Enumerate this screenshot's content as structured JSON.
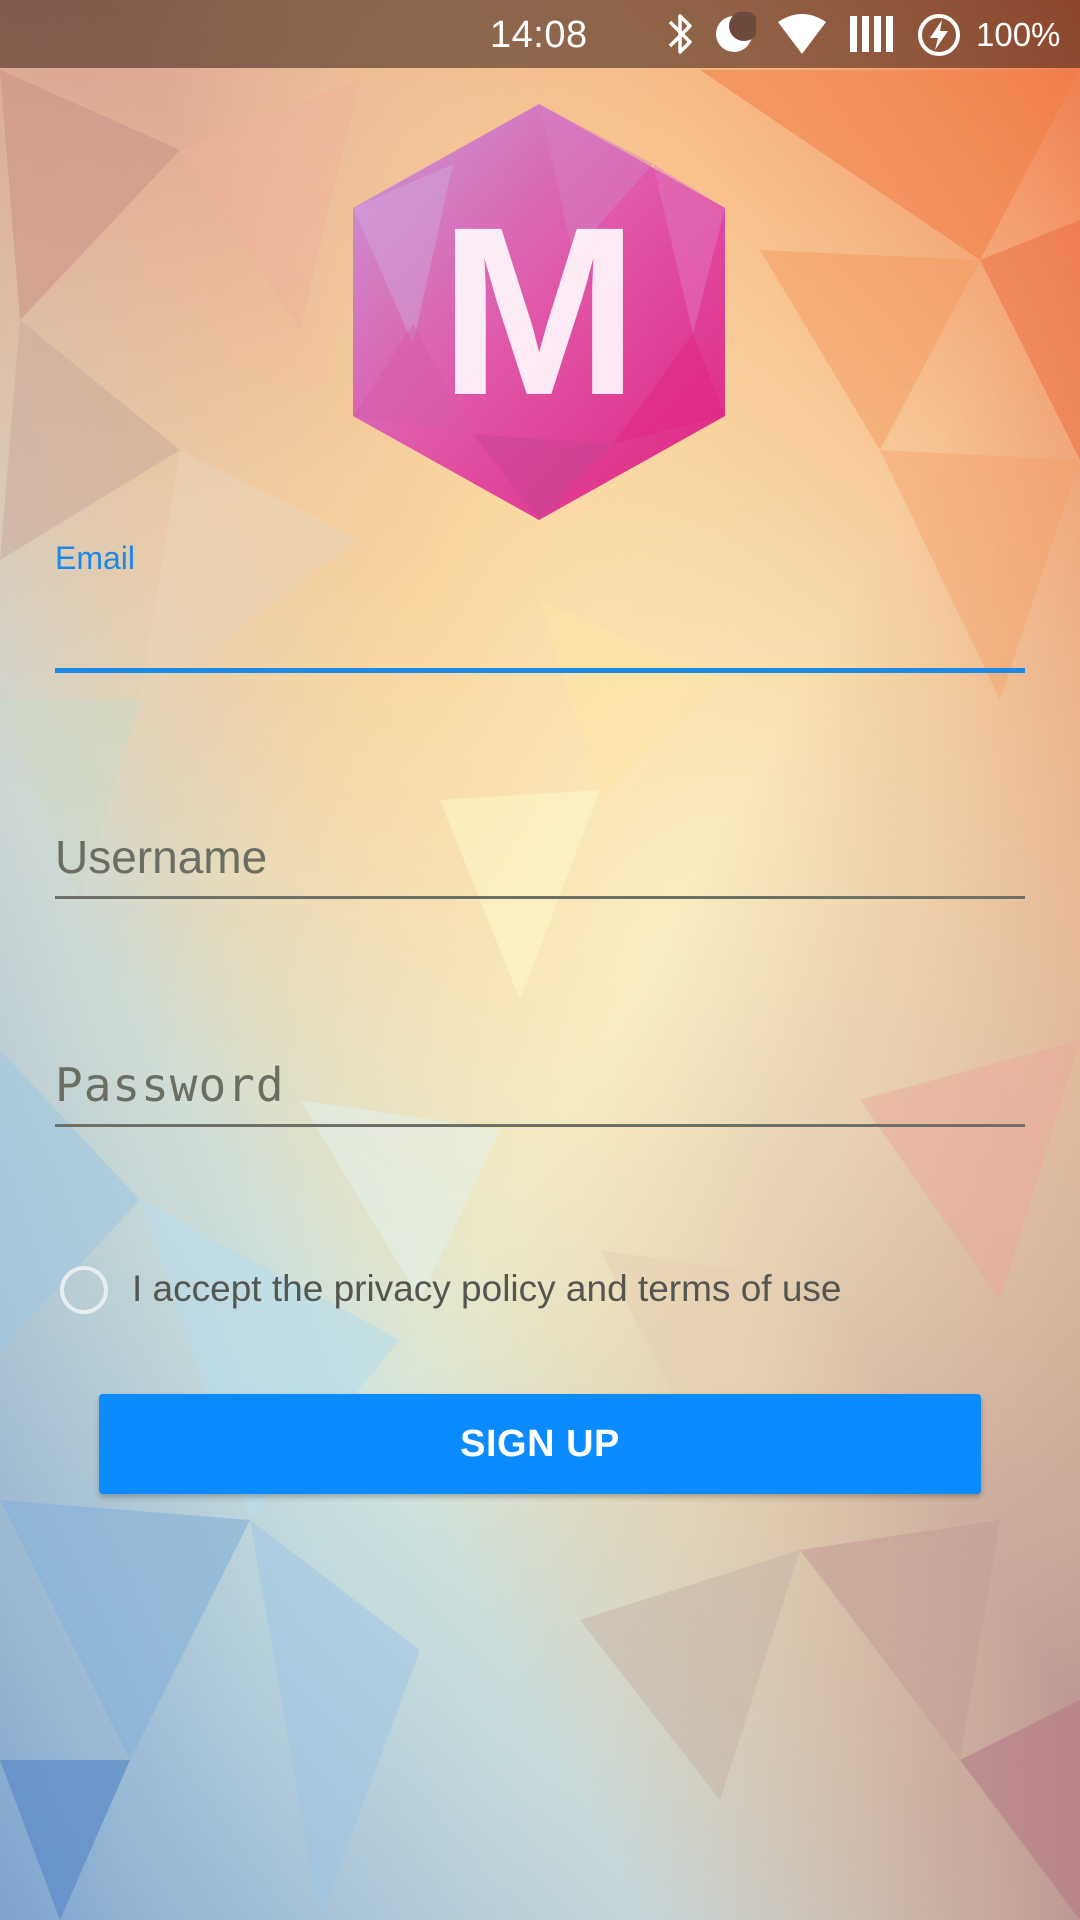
{
  "status_bar": {
    "time": "14:08",
    "battery_percent": "100%",
    "icons": [
      "bluetooth-icon",
      "do-not-disturb-moon-icon",
      "wifi-icon",
      "signal-bars-icon",
      "battery-charging-icon"
    ]
  },
  "logo": {
    "letter": "M",
    "colors": {
      "hex_top": "#c98ad4",
      "hex_mid": "#e356a6",
      "hex_bottom": "#d03c8c"
    }
  },
  "form": {
    "email": {
      "label": "Email",
      "value": ""
    },
    "username": {
      "placeholder": "Username",
      "value": ""
    },
    "password": {
      "placeholder": "Password",
      "value": ""
    },
    "terms": {
      "label": "I accept the privacy policy and terms of use",
      "checked": false
    },
    "submit": {
      "label": "SIGN UP"
    }
  },
  "colors": {
    "accent": "#1e88e5",
    "button": "#0a8bff"
  }
}
